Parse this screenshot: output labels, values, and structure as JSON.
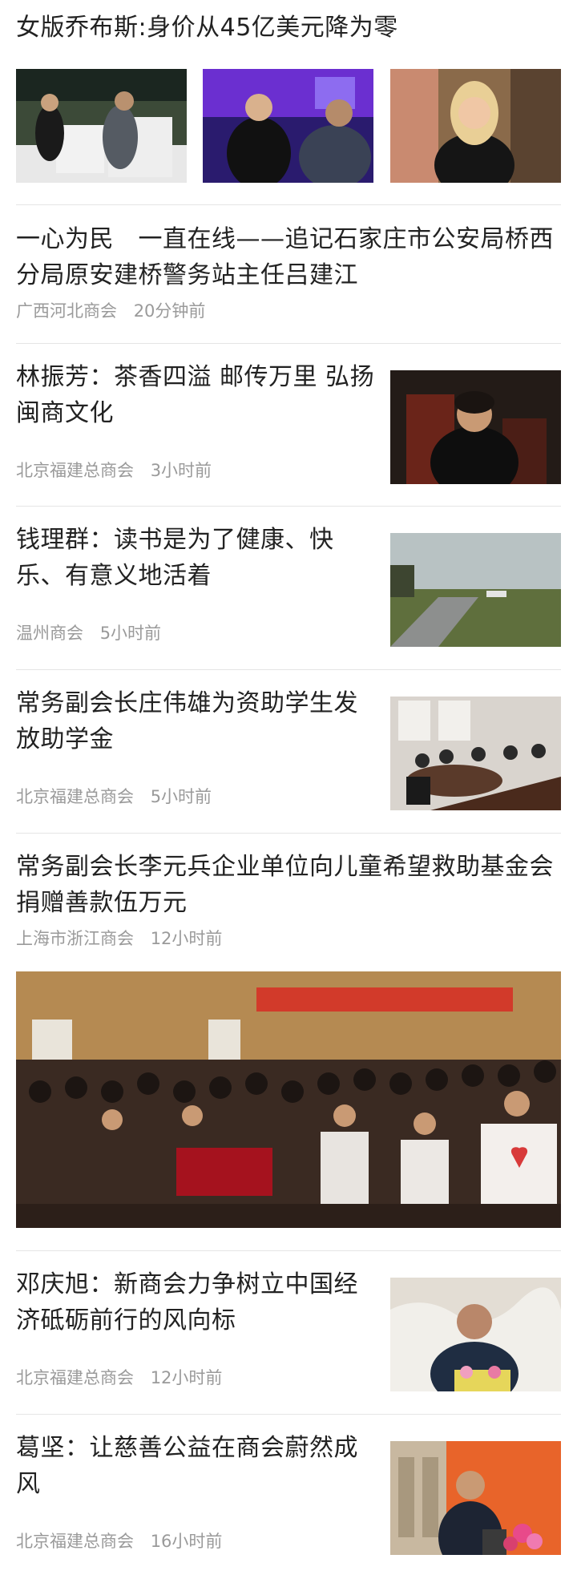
{
  "articles": [
    {
      "title": "女版乔布斯:身价从45亿美元降为零",
      "images": [
        "stage-interview-photo",
        "stage-speaker-photo",
        "portrait-photo"
      ]
    },
    {
      "title": "一心为民　一直在线——追记石家庄市公安局桥西分局原安建桥警务站主任吕建江",
      "source": "广西河北商会",
      "time": "20分钟前"
    },
    {
      "title": "林振芳：茶香四溢 邮传万里 弘扬闽商文化",
      "source": "北京福建总商会",
      "time": "3小时前",
      "thumbnail": "portrait-chair-photo"
    },
    {
      "title": "钱理群：读书是为了健康、快乐、有意义地活着",
      "source": "温州商会",
      "time": "5小时前",
      "thumbnail": "road-landscape-photo"
    },
    {
      "title": "常务副会长庄伟雄为资助学生发放助学金",
      "source": "北京福建总商会",
      "time": "5小时前",
      "thumbnail": "meeting-room-photo"
    },
    {
      "title": "常务副会长李元兵企业单位向儿童希望救助基金会捐赠善款伍万元",
      "source": "上海市浙江商会",
      "time": "12小时前",
      "image": "charity-gala-audience-photo"
    },
    {
      "title": "邓庆旭：新商会力争树立中国经济砥砺前行的风向标",
      "source": "北京福建总商会",
      "time": "12小时前",
      "thumbnail": "speaker-podium-photo"
    },
    {
      "title": "葛坚：让慈善公益在商会蔚然成风",
      "source": "北京福建总商会",
      "time": "16小时前",
      "thumbnail": "speaker-red-background-photo"
    }
  ]
}
